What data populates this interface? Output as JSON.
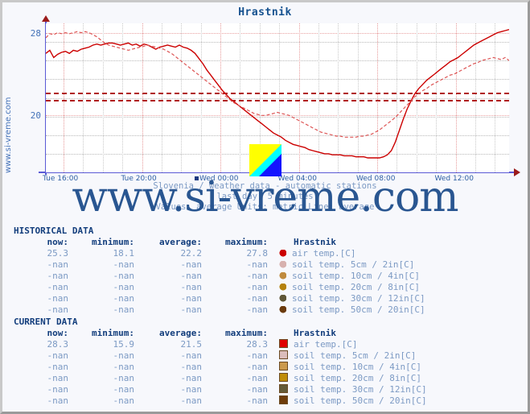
{
  "page": {
    "background": "#f7f8fc",
    "side_label": "www.si-vreme.com",
    "watermark": "www.si-vreme.com"
  },
  "chart": {
    "title": "Hrastnik",
    "subtitle_line1": "Slovenia / weather data - automatic stations",
    "subtitle_line2": "last day, 5 minutes",
    "subtitle_line3": "Values: average  Units: metric  Line: average",
    "logo_alt": "si-vreme-logo"
  },
  "chart_data": {
    "type": "line",
    "title": "Hrastnik",
    "xlabel": "",
    "ylabel": "",
    "ylim": [
      14.5,
      28.9
    ],
    "yticks": [
      20,
      28
    ],
    "ytick_labels": [
      "20",
      "28"
    ],
    "xticks": [
      "Tue 16:00",
      "Tue 20:00",
      "Wed 00:00",
      "Wed 04:00",
      "Wed 08:00",
      "Wed 12:00"
    ],
    "grid": true,
    "legend_position": "table-below",
    "annotations": [
      {
        "label": "historical average",
        "y": 21.5,
        "style": "dashed",
        "color": "#b01818"
      },
      {
        "label": "current average",
        "y": 22.2,
        "style": "dashed",
        "color": "#b01818"
      }
    ],
    "series": [
      {
        "name": "air temp.[C] (current)",
        "color": "#cc0000",
        "style": "solid",
        "values": [
          26.0,
          26.3,
          25.6,
          25.9,
          26.1,
          26.2,
          26.0,
          26.3,
          26.2,
          26.4,
          26.5,
          26.6,
          26.8,
          26.9,
          26.8,
          26.9,
          27.0,
          27.0,
          26.9,
          26.8,
          26.9,
          27.0,
          26.8,
          26.9,
          26.7,
          26.9,
          26.8,
          26.6,
          26.4,
          26.6,
          26.7,
          26.8,
          26.7,
          26.6,
          26.8,
          26.6,
          26.5,
          26.3,
          26.0,
          25.5,
          25.0,
          24.4,
          23.9,
          23.4,
          22.9,
          22.4,
          22.0,
          21.6,
          21.3,
          21.0,
          20.7,
          20.4,
          20.1,
          19.8,
          19.5,
          19.2,
          18.9,
          18.6,
          18.3,
          18.1,
          17.9,
          17.6,
          17.4,
          17.2,
          17.1,
          17.0,
          16.9,
          16.7,
          16.6,
          16.5,
          16.4,
          16.3,
          16.3,
          16.2,
          16.2,
          16.2,
          16.1,
          16.1,
          16.1,
          16.0,
          16.0,
          16.0,
          15.9,
          15.9,
          15.9,
          15.9,
          16.0,
          16.2,
          16.6,
          17.4,
          18.5,
          19.6,
          20.6,
          21.4,
          22.1,
          22.6,
          23.0,
          23.4,
          23.7,
          24.0,
          24.3,
          24.6,
          24.9,
          25.2,
          25.4,
          25.6,
          25.9,
          26.2,
          26.5,
          26.8,
          27.0,
          27.2,
          27.4,
          27.6,
          27.8,
          28.0,
          28.1,
          28.2,
          28.3
        ]
      },
      {
        "name": "air temp.[C] (historical)",
        "color": "#dd5555",
        "style": "dashed",
        "values": [
          27.5,
          27.9,
          27.8,
          28.0,
          27.9,
          28.0,
          27.9,
          28.0,
          28.1,
          28.0,
          28.1,
          28.0,
          27.8,
          27.6,
          27.3,
          27.0,
          26.8,
          26.7,
          26.6,
          26.5,
          26.4,
          26.3,
          26.4,
          26.5,
          26.6,
          26.7,
          26.8,
          26.7,
          26.6,
          26.5,
          26.4,
          26.2,
          26.0,
          25.7,
          25.4,
          25.1,
          24.8,
          24.5,
          24.2,
          23.9,
          23.6,
          23.3,
          23.0,
          22.7,
          22.4,
          22.1,
          21.8,
          21.5,
          21.2,
          21.0,
          20.8,
          20.6,
          20.4,
          20.2,
          20.1,
          20.0,
          20.0,
          20.1,
          20.2,
          20.3,
          20.2,
          20.1,
          20.0,
          19.8,
          19.6,
          19.4,
          19.2,
          19.0,
          18.8,
          18.6,
          18.4,
          18.3,
          18.2,
          18.1,
          18.0,
          18.0,
          17.9,
          17.9,
          17.9,
          17.9,
          18.0,
          18.0,
          18.1,
          18.2,
          18.4,
          18.6,
          18.9,
          19.2,
          19.5,
          19.8,
          20.2,
          20.6,
          21.0,
          21.4,
          21.8,
          22.1,
          22.4,
          22.6,
          22.9,
          23.1,
          23.3,
          23.5,
          23.7,
          23.9,
          24.0,
          24.2,
          24.4,
          24.6,
          24.8,
          25.0,
          25.1,
          25.3,
          25.4,
          25.5,
          25.6,
          25.5,
          25.4,
          25.6,
          25.3
        ]
      }
    ]
  },
  "tables": [
    {
      "id": "historical",
      "section_title": "HISTORICAL DATA",
      "headers": [
        "now:",
        "minimum:",
        "average:",
        "maximum:",
        "Hrastnik"
      ],
      "rows": [
        {
          "now": "25.3",
          "minimum": "18.1",
          "average": "22.2",
          "maximum": "27.8",
          "color": "#cc0000",
          "label": "air temp.[C]"
        },
        {
          "now": "-nan",
          "minimum": "-nan",
          "average": "-nan",
          "maximum": "-nan",
          "color": "#d7b1ae",
          "label": "soil temp. 5cm / 2in[C]"
        },
        {
          "now": "-nan",
          "minimum": "-nan",
          "average": "-nan",
          "maximum": "-nan",
          "color": "#c08b3e",
          "label": "soil temp. 10cm / 4in[C]"
        },
        {
          "now": "-nan",
          "minimum": "-nan",
          "average": "-nan",
          "maximum": "-nan",
          "color": "#b5820d",
          "label": "soil temp. 20cm / 8in[C]"
        },
        {
          "now": "-nan",
          "minimum": "-nan",
          "average": "-nan",
          "maximum": "-nan",
          "color": "#5f5636",
          "label": "soil temp. 30cm / 12in[C]"
        },
        {
          "now": "-nan",
          "minimum": "-nan",
          "average": "-nan",
          "maximum": "-nan",
          "color": "#6b3a0c",
          "label": "soil temp. 50cm / 20in[C]"
        }
      ]
    },
    {
      "id": "current",
      "section_title": "CURRENT DATA",
      "headers": [
        "now:",
        "minimum:",
        "average:",
        "maximum:",
        "Hrastnik"
      ],
      "rows": [
        {
          "now": "28.3",
          "minimum": "15.9",
          "average": "21.5",
          "maximum": "28.3",
          "color": "#e00000",
          "label": "air temp.[C]"
        },
        {
          "now": "-nan",
          "minimum": "-nan",
          "average": "-nan",
          "maximum": "-nan",
          "color": "#dbbdbb",
          "label": "soil temp. 5cm / 2in[C]"
        },
        {
          "now": "-nan",
          "minimum": "-nan",
          "average": "-nan",
          "maximum": "-nan",
          "color": "#cb9a4e",
          "label": "soil temp. 10cm / 4in[C]"
        },
        {
          "now": "-nan",
          "minimum": "-nan",
          "average": "-nan",
          "maximum": "-nan",
          "color": "#c08d0a",
          "label": "soil temp. 20cm / 8in[C]"
        },
        {
          "now": "-nan",
          "minimum": "-nan",
          "average": "-nan",
          "maximum": "-nan",
          "color": "#645b38",
          "label": "soil temp. 30cm / 12in[C]"
        },
        {
          "now": "-nan",
          "minimum": "-nan",
          "average": "-nan",
          "maximum": "-nan",
          "color": "#6e3c0b",
          "label": "soil temp. 50cm / 20in[C]"
        }
      ]
    }
  ]
}
